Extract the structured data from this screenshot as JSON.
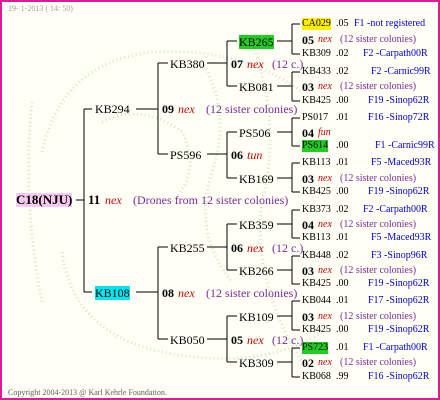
{
  "header": {
    "date_text": "19-  1-2013 ( 14: 50)"
  },
  "footer": {
    "copyright": "Copyright 2004-2013 @ Karl Kehrle Foundation."
  },
  "root": {
    "id": "C18(NJU)",
    "num": "11",
    "nex": "nex",
    "desc": "(Drones from 12 sister colonies)"
  },
  "gen1": [
    {
      "id": "KB294",
      "num": "09",
      "nex": "nex",
      "desc": "(12 sister colonies)"
    },
    {
      "id": "KB108",
      "num": "08",
      "nex": "nex",
      "desc": "(12 sister colonies)"
    }
  ],
  "gen2": [
    {
      "id": "KB380",
      "num": "07",
      "nex": "nex",
      "desc": "(12 c.)"
    },
    {
      "id": "PS596",
      "num": "06",
      "nex": "tun",
      "desc": ""
    },
    {
      "id": "KB255",
      "num": "06",
      "nex": "nex",
      "desc": "(12 c.)"
    },
    {
      "id": "KB050",
      "num": "05",
      "nex": "nex",
      "desc": "(12 c.)"
    }
  ],
  "gen3": [
    {
      "id": "KB265",
      "num": "05",
      "nex": "nex",
      "desc": "(12 sister colonies)"
    },
    {
      "id": "KB081",
      "num": "03",
      "nex": "nex",
      "desc": "(12 sister colonies)"
    },
    {
      "id": "PS506",
      "num": "04",
      "nex": "fun",
      "desc": ""
    },
    {
      "id": "KB169",
      "num": "03",
      "nex": "nex",
      "desc": "(12 sister colonies)"
    },
    {
      "id": "KB359",
      "num": "04",
      "nex": "nex",
      "desc": "(12 sister colonies)"
    },
    {
      "id": "KB266",
      "num": "03",
      "nex": "nex",
      "desc": "(12 sister colonies)"
    },
    {
      "id": "KB109",
      "num": "03",
      "nex": "nex",
      "desc": "(12 sister colonies)"
    },
    {
      "id": "KB309",
      "num": "02",
      "nex": "nex",
      "desc": "(12 sister colonies)"
    }
  ],
  "gen4": [
    {
      "id": "CA029",
      "num": ".05",
      "origin": "F1 -not registered"
    },
    {
      "id": "KB309",
      "num": ".02",
      "origin": "F2 -Carpath00R"
    },
    {
      "id": "KB433",
      "num": ".02",
      "origin": "F2 -Carnic99R"
    },
    {
      "id": "KB425",
      "num": ".00",
      "origin": "F19 -Sinop62R"
    },
    {
      "id": "PS017",
      "num": ".01",
      "origin": "F16 -Sinop72R"
    },
    {
      "id": "PS614",
      "num": ".00",
      "origin": "F1 -Carnic99R"
    },
    {
      "id": "KB113",
      "num": ".01",
      "origin": "F5 -Maced93R"
    },
    {
      "id": "KB425",
      "num": ".00",
      "origin": "F19 -Sinop62R"
    },
    {
      "id": "KB373",
      "num": ".02",
      "origin": "F2 -Carpath00R"
    },
    {
      "id": "KB113",
      "num": ".01",
      "origin": "F5 -Maced93R"
    },
    {
      "id": "KB448",
      "num": ".02",
      "origin": "F3 -Sinop96R"
    },
    {
      "id": "KB425",
      "num": ".00",
      "origin": "F19 -Sinop62R"
    },
    {
      "id": "KB044",
      "num": ".01",
      "origin": "F17 -Sinop62R"
    },
    {
      "id": "KB425",
      "num": ".00",
      "origin": "F19 -Sinop62R"
    },
    {
      "id": "PS723",
      "num": ".01",
      "origin": "F1 -Carpath00R"
    },
    {
      "id": "KB068",
      "num": ".99",
      "origin": "F16 -Sinop62R"
    }
  ]
}
